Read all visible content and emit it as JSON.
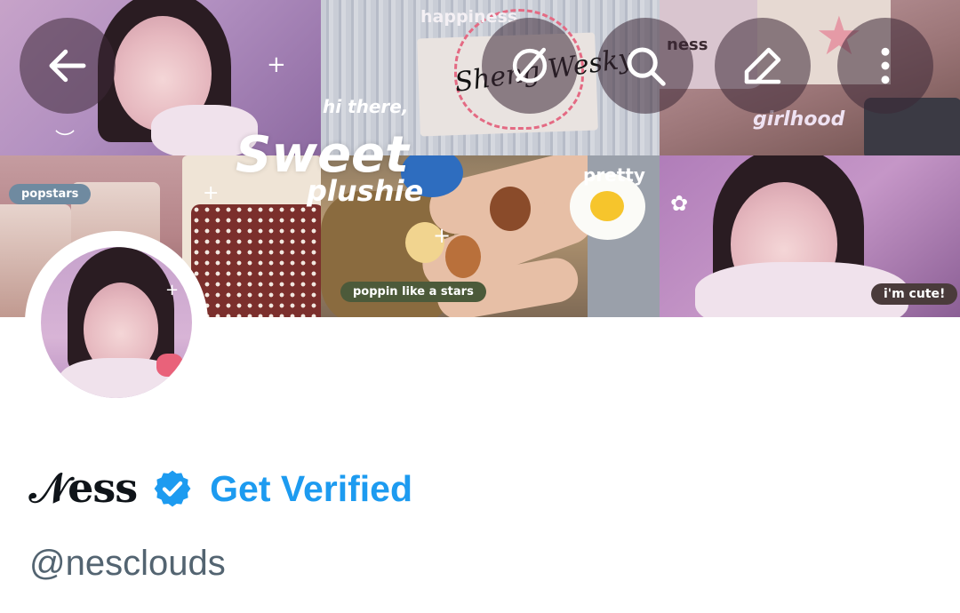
{
  "banner": {
    "sticker_happiness": "happiness",
    "sticker_hi_there": "hi there,",
    "sticker_girlhood": "girlhood",
    "sticker_popstars": "popstars",
    "sticker_sweet": "Sweet",
    "sticker_plushie": "plushie",
    "sticker_pretty": "pretty",
    "sticker_poppin": "poppin like a stars",
    "sticker_im_cute": "i'm cute!",
    "sticker_ness_small": "ness",
    "signature": "Sheng Wesky"
  },
  "top_bar": {
    "back_icon": "arrow-left-icon",
    "grok_icon": "grok-icon",
    "search_icon": "search-icon",
    "edit_icon": "pencil-icon",
    "more_icon": "more-vertical-icon"
  },
  "profile": {
    "display_name": "𝒩ess",
    "verified_icon": "verified-badge-icon",
    "verified_color": "#1d9bf0",
    "get_verified_label": "Get Verified",
    "handle": "@nesclouds"
  }
}
